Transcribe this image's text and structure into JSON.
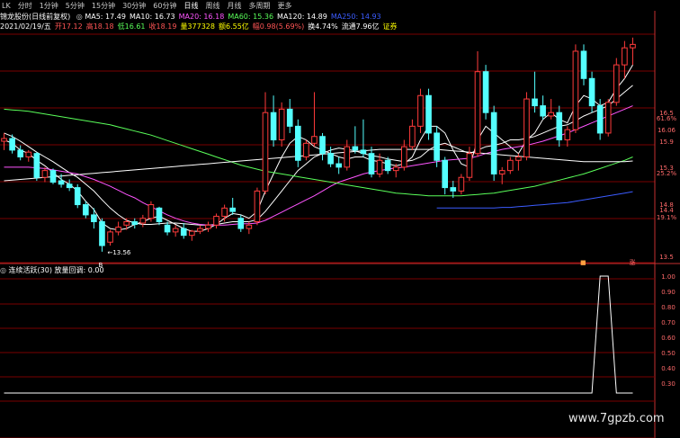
{
  "toolbar": {
    "items": [
      "LK",
      "分时",
      "1分钟",
      "5分钟",
      "15分钟",
      "30分钟",
      "60分钟",
      "日线",
      "周线",
      "月线",
      "多周期",
      "更多"
    ],
    "active": 7
  },
  "header": {
    "stock": "锦龙股份(日线前复权)",
    "ma": [
      {
        "label": "MA5: 17.49",
        "color": "#ffffff"
      },
      {
        "label": "MA10: 16.73",
        "color": "#ffffff"
      },
      {
        "label": "MA20: 16.18",
        "color": "#ff55ff"
      },
      {
        "label": "MA60: 15.36",
        "color": "#5aff5a"
      },
      {
        "label": "MA120: 14.89",
        "color": "#ffffff"
      },
      {
        "label": "MA250: 14.93",
        "color": "#3b5cff"
      }
    ],
    "line2": [
      {
        "label": "2021/02/19/五",
        "color": "#ffffff"
      },
      {
        "label": "开17.12",
        "color": "#ff5555"
      },
      {
        "label": "高18.18",
        "color": "#ff5555"
      },
      {
        "label": "低16.61",
        "color": "#5aff5a"
      },
      {
        "label": "收18.19",
        "color": "#ff5555"
      },
      {
        "label": "量377328",
        "color": "#ffff00"
      },
      {
        "label": "额6.55亿",
        "color": "#ffff00"
      },
      {
        "label": "幅0.98(5.69%)",
        "color": "#ff5555"
      },
      {
        "label": "换4.74%",
        "color": "#ffffff"
      },
      {
        "label": "流通7.96亿",
        "color": "#ffffff"
      },
      {
        "label": "证券",
        "color": "#ffff00"
      }
    ]
  },
  "colors": {
    "up": "#ff3b3b",
    "down": "#54ffff",
    "grid": "#7a0000",
    "axis": "#c43030"
  },
  "price_axis": {
    "labels": [
      "16.5",
      "61.6%",
      "16.06",
      "15.9",
      "15.3",
      "25.2%",
      "14.8",
      "19.1%",
      "14.4",
      "13.5"
    ]
  },
  "marks": {
    "low_label": "13.56",
    "buy_label": "B",
    "tag1": "■",
    "tag2": "涨"
  },
  "indicator": {
    "title": "连续活跃(30)",
    "value_label": "放量回调: 0.00",
    "axis_labels": [
      "1.00",
      "0.90",
      "0.80",
      "0.70",
      "0.60",
      "0.50",
      "0.40",
      "0.30"
    ]
  },
  "watermark": "www.7gpzb.com",
  "chart_data": {
    "type": "candlestick",
    "candles": [
      {
        "o": 15.18,
        "h": 15.3,
        "l": 15.05,
        "c": 15.22
      },
      {
        "o": 15.22,
        "h": 15.28,
        "l": 15.0,
        "c": 15.05
      },
      {
        "o": 15.05,
        "h": 15.12,
        "l": 14.9,
        "c": 14.95
      },
      {
        "o": 14.95,
        "h": 15.05,
        "l": 14.88,
        "c": 15.02
      },
      {
        "o": 15.0,
        "h": 15.02,
        "l": 14.6,
        "c": 14.65
      },
      {
        "o": 14.65,
        "h": 14.8,
        "l": 14.58,
        "c": 14.75
      },
      {
        "o": 14.75,
        "h": 14.78,
        "l": 14.55,
        "c": 14.58
      },
      {
        "o": 14.6,
        "h": 14.7,
        "l": 14.5,
        "c": 14.55
      },
      {
        "o": 14.55,
        "h": 14.62,
        "l": 14.45,
        "c": 14.5
      },
      {
        "o": 14.5,
        "h": 14.55,
        "l": 14.2,
        "c": 14.25
      },
      {
        "o": 14.25,
        "h": 14.3,
        "l": 14.05,
        "c": 14.1
      },
      {
        "o": 14.1,
        "h": 14.2,
        "l": 13.9,
        "c": 14.0
      },
      {
        "o": 14.0,
        "h": 14.05,
        "l": 13.56,
        "c": 13.65
      },
      {
        "o": 13.7,
        "h": 13.88,
        "l": 13.65,
        "c": 13.85
      },
      {
        "o": 13.85,
        "h": 14.0,
        "l": 13.8,
        "c": 13.92
      },
      {
        "o": 13.95,
        "h": 14.05,
        "l": 13.88,
        "c": 14.0
      },
      {
        "o": 14.0,
        "h": 14.05,
        "l": 13.9,
        "c": 13.96
      },
      {
        "o": 13.98,
        "h": 14.1,
        "l": 13.92,
        "c": 14.05
      },
      {
        "o": 14.05,
        "h": 14.3,
        "l": 14.0,
        "c": 14.25
      },
      {
        "o": 14.2,
        "h": 14.22,
        "l": 13.95,
        "c": 14.0
      },
      {
        "o": 13.95,
        "h": 14.0,
        "l": 13.8,
        "c": 13.85
      },
      {
        "o": 13.85,
        "h": 13.95,
        "l": 13.78,
        "c": 13.9
      },
      {
        "o": 13.9,
        "h": 13.98,
        "l": 13.75,
        "c": 13.8
      },
      {
        "o": 13.8,
        "h": 13.88,
        "l": 13.72,
        "c": 13.86
      },
      {
        "o": 13.86,
        "h": 13.95,
        "l": 13.82,
        "c": 13.9
      },
      {
        "o": 13.9,
        "h": 14.0,
        "l": 13.85,
        "c": 13.95
      },
      {
        "o": 13.95,
        "h": 14.12,
        "l": 13.9,
        "c": 14.08
      },
      {
        "o": 14.08,
        "h": 14.25,
        "l": 14.0,
        "c": 14.2
      },
      {
        "o": 14.2,
        "h": 14.35,
        "l": 14.1,
        "c": 14.15
      },
      {
        "o": 14.05,
        "h": 14.1,
        "l": 13.85,
        "c": 13.9
      },
      {
        "o": 13.9,
        "h": 14.0,
        "l": 13.82,
        "c": 13.95
      },
      {
        "o": 14.0,
        "h": 14.5,
        "l": 13.95,
        "c": 14.45
      },
      {
        "o": 14.45,
        "h": 15.9,
        "l": 14.4,
        "c": 15.6
      },
      {
        "o": 15.6,
        "h": 15.85,
        "l": 15.1,
        "c": 15.2
      },
      {
        "o": 15.2,
        "h": 15.75,
        "l": 15.1,
        "c": 15.65
      },
      {
        "o": 15.65,
        "h": 15.8,
        "l": 15.3,
        "c": 15.4
      },
      {
        "o": 15.4,
        "h": 15.5,
        "l": 14.8,
        "c": 14.9
      },
      {
        "o": 14.95,
        "h": 15.2,
        "l": 14.9,
        "c": 15.15
      },
      {
        "o": 15.15,
        "h": 15.9,
        "l": 15.1,
        "c": 15.25
      },
      {
        "o": 15.25,
        "h": 15.3,
        "l": 14.9,
        "c": 15.0
      },
      {
        "o": 15.0,
        "h": 15.1,
        "l": 14.8,
        "c": 14.85
      },
      {
        "o": 14.85,
        "h": 14.95,
        "l": 14.7,
        "c": 14.8
      },
      {
        "o": 14.8,
        "h": 15.2,
        "l": 14.75,
        "c": 15.1
      },
      {
        "o": 15.1,
        "h": 15.4,
        "l": 15.0,
        "c": 15.05
      },
      {
        "o": 15.05,
        "h": 15.5,
        "l": 14.95,
        "c": 15.0
      },
      {
        "o": 15.0,
        "h": 15.1,
        "l": 14.65,
        "c": 14.7
      },
      {
        "o": 14.7,
        "h": 15.0,
        "l": 14.65,
        "c": 14.9
      },
      {
        "o": 14.9,
        "h": 14.95,
        "l": 14.7,
        "c": 14.75
      },
      {
        "o": 14.75,
        "h": 14.85,
        "l": 14.65,
        "c": 14.8
      },
      {
        "o": 14.8,
        "h": 15.2,
        "l": 14.75,
        "c": 15.1
      },
      {
        "o": 15.1,
        "h": 15.5,
        "l": 15.05,
        "c": 15.4
      },
      {
        "o": 15.4,
        "h": 15.95,
        "l": 15.3,
        "c": 15.85
      },
      {
        "o": 15.85,
        "h": 15.95,
        "l": 15.2,
        "c": 15.3
      },
      {
        "o": 15.3,
        "h": 15.4,
        "l": 14.8,
        "c": 14.9
      },
      {
        "o": 14.9,
        "h": 14.95,
        "l": 14.4,
        "c": 14.5
      },
      {
        "o": 14.5,
        "h": 14.6,
        "l": 14.35,
        "c": 14.45
      },
      {
        "o": 14.45,
        "h": 14.7,
        "l": 14.4,
        "c": 14.65
      },
      {
        "o": 14.65,
        "h": 15.1,
        "l": 14.6,
        "c": 15.0
      },
      {
        "o": 15.0,
        "h": 16.5,
        "l": 14.95,
        "c": 16.2
      },
      {
        "o": 16.2,
        "h": 16.3,
        "l": 15.5,
        "c": 15.6
      },
      {
        "o": 15.6,
        "h": 15.7,
        "l": 14.6,
        "c": 14.7
      },
      {
        "o": 14.7,
        "h": 14.8,
        "l": 14.55,
        "c": 14.75
      },
      {
        "o": 14.75,
        "h": 14.95,
        "l": 14.7,
        "c": 14.9
      },
      {
        "o": 14.9,
        "h": 15.0,
        "l": 14.75,
        "c": 14.95
      },
      {
        "o": 14.95,
        "h": 15.9,
        "l": 14.9,
        "c": 15.8
      },
      {
        "o": 15.8,
        "h": 16.2,
        "l": 15.6,
        "c": 15.7
      },
      {
        "o": 15.7,
        "h": 15.85,
        "l": 15.5,
        "c": 15.55
      },
      {
        "o": 15.55,
        "h": 15.8,
        "l": 15.5,
        "c": 15.6
      },
      {
        "o": 15.6,
        "h": 15.7,
        "l": 15.1,
        "c": 15.2
      },
      {
        "o": 15.2,
        "h": 15.4,
        "l": 15.1,
        "c": 15.35
      },
      {
        "o": 15.35,
        "h": 16.6,
        "l": 15.3,
        "c": 16.5
      },
      {
        "o": 16.5,
        "h": 16.6,
        "l": 16.0,
        "c": 16.1
      },
      {
        "o": 16.1,
        "h": 16.2,
        "l": 15.6,
        "c": 15.7
      },
      {
        "o": 15.7,
        "h": 15.8,
        "l": 15.2,
        "c": 15.3
      },
      {
        "o": 15.3,
        "h": 15.8,
        "l": 15.25,
        "c": 15.75
      },
      {
        "o": 15.75,
        "h": 16.4,
        "l": 15.7,
        "c": 16.3
      },
      {
        "o": 16.3,
        "h": 16.65,
        "l": 16.1,
        "c": 16.55
      },
      {
        "o": 16.55,
        "h": 16.7,
        "l": 16.3,
        "c": 16.6
      }
    ],
    "ma_lines": [
      {
        "name": "MA5",
        "color": "#ffffff",
        "values": [
          15.2,
          15.15,
          15.05,
          15.0,
          14.9,
          14.82,
          14.72,
          14.62,
          14.55,
          14.45,
          14.3,
          14.18,
          13.98,
          13.9,
          13.88,
          13.9,
          13.96,
          14.0,
          14.05,
          14.08,
          14.02,
          13.96,
          13.9,
          13.86,
          13.86,
          13.9,
          13.96,
          14.05,
          14.12,
          14.1,
          14.05,
          14.15,
          14.45,
          14.7,
          14.95,
          15.15,
          15.25,
          15.2,
          15.1,
          15.05,
          15.0,
          14.95,
          14.92,
          14.95,
          14.95,
          14.9,
          14.88,
          14.85,
          14.82,
          14.85,
          14.95,
          15.2,
          15.4,
          15.4,
          15.3,
          15.05,
          14.85,
          14.8,
          15.2,
          15.4,
          15.3,
          15.2,
          15.1,
          15.0,
          15.2,
          15.3,
          15.5,
          15.6,
          15.5,
          15.45,
          15.7,
          15.85,
          15.8,
          15.7,
          15.75,
          15.95,
          16.1,
          16.3
        ]
      },
      {
        "name": "MA10",
        "color": "#ffffff",
        "values": [
          15.3,
          15.25,
          15.18,
          15.1,
          15.02,
          14.95,
          14.88,
          14.8,
          14.72,
          14.65,
          14.55,
          14.45,
          14.32,
          14.2,
          14.1,
          14.02,
          13.98,
          13.96,
          13.96,
          13.97,
          13.98,
          13.98,
          13.97,
          13.96,
          13.95,
          13.95,
          13.96,
          13.98,
          14.0,
          14.0,
          14.0,
          14.03,
          14.15,
          14.3,
          14.45,
          14.6,
          14.75,
          14.85,
          14.95,
          15.0,
          15.05,
          15.08,
          15.06,
          15.04,
          15.0,
          14.97,
          14.95,
          14.92,
          14.9,
          14.88,
          14.9,
          14.95,
          15.05,
          15.12,
          15.15,
          15.1,
          15.05,
          15.0,
          15.05,
          15.1,
          15.12,
          15.15,
          15.2,
          15.2,
          15.22,
          15.25,
          15.3,
          15.35,
          15.4,
          15.42,
          15.48,
          15.55,
          15.6,
          15.65,
          15.7,
          15.8,
          15.9,
          16.0
        ]
      },
      {
        "name": "MA20",
        "color": "#ff55ff",
        "values": [
          14.8,
          14.8,
          14.8,
          14.8,
          14.79,
          14.78,
          14.76,
          14.74,
          14.72,
          14.7,
          14.66,
          14.62,
          14.57,
          14.52,
          14.46,
          14.4,
          14.35,
          14.28,
          14.22,
          14.16,
          14.1,
          14.05,
          14.01,
          13.98,
          13.96,
          13.95,
          13.95,
          13.95,
          13.96,
          13.97,
          13.97,
          13.98,
          14.02,
          14.08,
          14.14,
          14.2,
          14.26,
          14.32,
          14.38,
          14.45,
          14.52,
          14.58,
          14.62,
          14.66,
          14.7,
          14.73,
          14.75,
          14.77,
          14.79,
          14.8,
          14.82,
          14.84,
          14.86,
          14.88,
          14.9,
          14.91,
          14.92,
          14.93,
          14.96,
          15.0,
          15.03,
          15.06,
          15.08,
          15.1,
          15.12,
          15.15,
          15.18,
          15.22,
          15.26,
          15.3,
          15.35,
          15.4,
          15.45,
          15.5,
          15.55,
          15.6,
          15.65,
          15.7
        ]
      },
      {
        "name": "MA60",
        "color": "#5aff5a",
        "values": [
          15.65,
          15.64,
          15.63,
          15.62,
          15.6,
          15.58,
          15.56,
          15.54,
          15.52,
          15.5,
          15.48,
          15.46,
          15.44,
          15.42,
          15.39,
          15.36,
          15.33,
          15.3,
          15.27,
          15.23,
          15.19,
          15.15,
          15.11,
          15.07,
          15.03,
          14.99,
          14.95,
          14.91,
          14.87,
          14.83,
          14.8,
          14.77,
          14.74,
          14.72,
          14.7,
          14.68,
          14.66,
          14.64,
          14.62,
          14.6,
          14.58,
          14.56,
          14.54,
          14.52,
          14.5,
          14.48,
          14.46,
          14.44,
          14.42,
          14.41,
          14.4,
          14.39,
          14.38,
          14.38,
          14.38,
          14.38,
          14.38,
          14.39,
          14.4,
          14.41,
          14.42,
          14.44,
          14.46,
          14.48,
          14.5,
          14.52,
          14.55,
          14.58,
          14.61,
          14.64,
          14.67,
          14.7,
          14.74,
          14.78,
          14.82,
          14.86,
          14.9,
          14.95
        ]
      },
      {
        "name": "MA120",
        "color": "#ffffff",
        "values": [
          14.6,
          14.61,
          14.62,
          14.63,
          14.64,
          14.65,
          14.66,
          14.67,
          14.68,
          14.69,
          14.7,
          14.71,
          14.72,
          14.73,
          14.74,
          14.75,
          14.76,
          14.77,
          14.78,
          14.79,
          14.8,
          14.81,
          14.82,
          14.83,
          14.84,
          14.85,
          14.86,
          14.87,
          14.88,
          14.89,
          14.9,
          14.91,
          14.92,
          14.93,
          14.94,
          14.95,
          14.96,
          14.97,
          14.98,
          14.99,
          15.0,
          15.01,
          15.02,
          15.03,
          15.04,
          15.05,
          15.06,
          15.06,
          15.06,
          15.06,
          15.06,
          15.06,
          15.06,
          15.06,
          15.05,
          15.04,
          15.03,
          15.02,
          15.01,
          15.0,
          14.99,
          14.98,
          14.97,
          14.96,
          14.95,
          14.94,
          14.93,
          14.92,
          14.91,
          14.9,
          14.89,
          14.88,
          14.88,
          14.88,
          14.88,
          14.88,
          14.88,
          14.89
        ]
      },
      {
        "name": "MA250",
        "color": "#3b5cff",
        "values": [
          null,
          null,
          null,
          null,
          null,
          null,
          null,
          null,
          null,
          null,
          null,
          null,
          null,
          null,
          null,
          null,
          null,
          null,
          null,
          null,
          null,
          null,
          null,
          null,
          null,
          null,
          null,
          null,
          null,
          null,
          null,
          null,
          null,
          null,
          null,
          null,
          null,
          null,
          null,
          null,
          null,
          null,
          null,
          null,
          null,
          null,
          null,
          null,
          null,
          null,
          null,
          null,
          null,
          14.2,
          14.2,
          14.2,
          14.2,
          14.2,
          14.2,
          14.2,
          14.2,
          14.21,
          14.21,
          14.22,
          14.23,
          14.24,
          14.25,
          14.26,
          14.27,
          14.28,
          14.3,
          14.32,
          14.34,
          14.36,
          14.38,
          14.4,
          14.42,
          14.44
        ]
      }
    ],
    "indicator_values": [
      0,
      0,
      0,
      0,
      0,
      0,
      0,
      0,
      0,
      0,
      0,
      0,
      0,
      0,
      0,
      0,
      0,
      0,
      0,
      0,
      0,
      0,
      0,
      0,
      0,
      0,
      0,
      0,
      0,
      0,
      0,
      0,
      0,
      0,
      0,
      0,
      0,
      0,
      0,
      0,
      0,
      0,
      0,
      0,
      0,
      0,
      0,
      0,
      0,
      0,
      0,
      0,
      0,
      0,
      0,
      0,
      0,
      0,
      0,
      0,
      0,
      0,
      0,
      0,
      0,
      0,
      0,
      0,
      0,
      0,
      0,
      0,
      0,
      1,
      1,
      0,
      0,
      0
    ],
    "ylim": [
      13.4,
      16.75
    ],
    "indicator_ylim": [
      0.25,
      1.05
    ]
  }
}
